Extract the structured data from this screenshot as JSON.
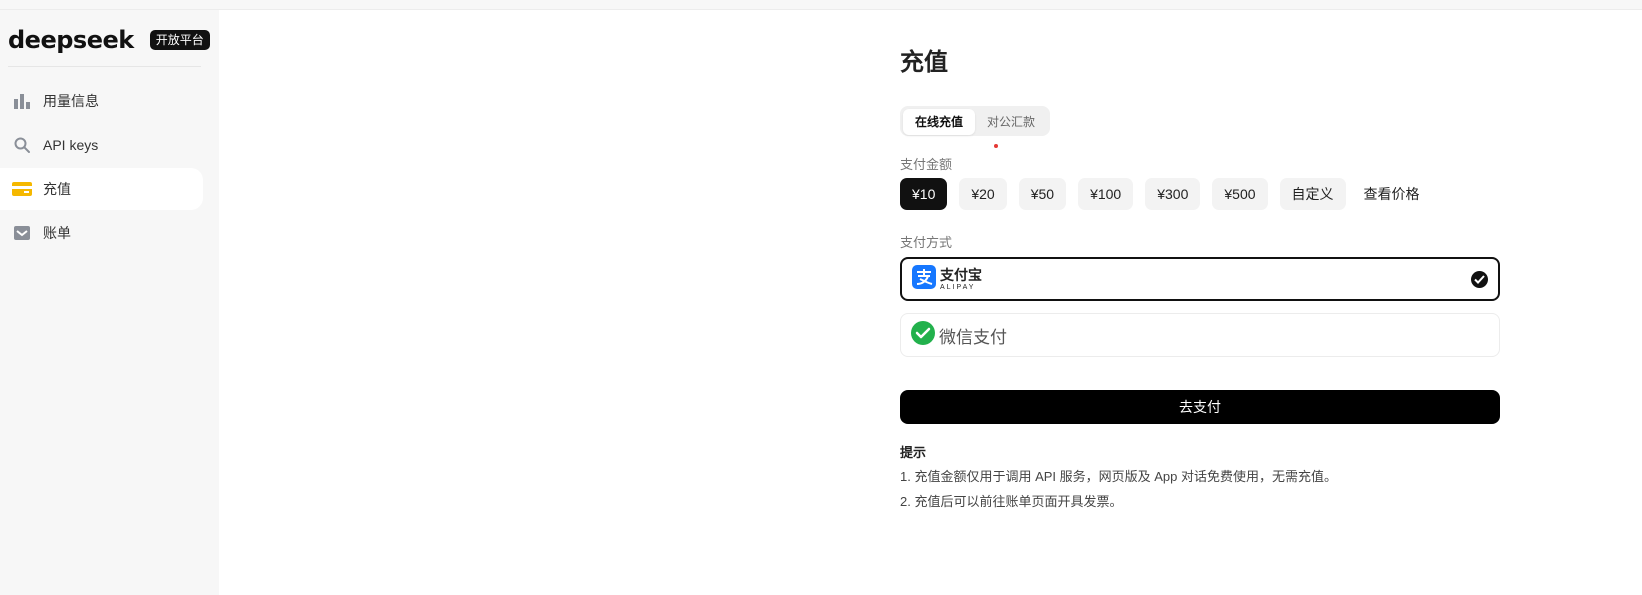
{
  "brand": {
    "name": "deepseek",
    "tag": "开放平台"
  },
  "sidebar": {
    "items": [
      {
        "label": "用量信息",
        "icon": "bar-chart-icon",
        "active": false
      },
      {
        "label": "API keys",
        "icon": "search-icon",
        "active": false
      },
      {
        "label": "充值",
        "icon": "credit-card-icon",
        "active": true
      },
      {
        "label": "账单",
        "icon": "inbox-icon",
        "active": false
      }
    ]
  },
  "main": {
    "title": "充值",
    "tabs": [
      {
        "label": "在线充值",
        "active": true
      },
      {
        "label": "对公汇款",
        "active": false
      }
    ],
    "amount_label": "支付金额",
    "amounts": [
      {
        "label": "¥10",
        "selected": true
      },
      {
        "label": "¥20",
        "selected": false
      },
      {
        "label": "¥50",
        "selected": false
      },
      {
        "label": "¥100",
        "selected": false
      },
      {
        "label": "¥300",
        "selected": false
      },
      {
        "label": "¥500",
        "selected": false
      },
      {
        "label": "自定义",
        "selected": false
      }
    ],
    "price_link": "查看价格",
    "method_label": "支付方式",
    "methods": [
      {
        "name_cn": "支付宝",
        "name_en": "ALIPAY",
        "icon": "alipay-icon",
        "selected": true
      },
      {
        "name_cn": "微信支付",
        "icon": "wechat-pay-icon",
        "selected": false
      }
    ],
    "pay_button": "去支付",
    "tips_title": "提示",
    "tips": [
      "1. 充值金额仅用于调用 API 服务，网页版及 App 对话免费使用，无需充值。",
      "2. 充值后可以前往账单页面开具发票。"
    ]
  },
  "colors": {
    "accent": "#000000",
    "sidebar_bg": "#f7f7f7",
    "card_icon": "#f5b800",
    "alipay_blue": "#1677ff",
    "wechat_green": "#22b14c",
    "notice_dot": "#e53935"
  }
}
